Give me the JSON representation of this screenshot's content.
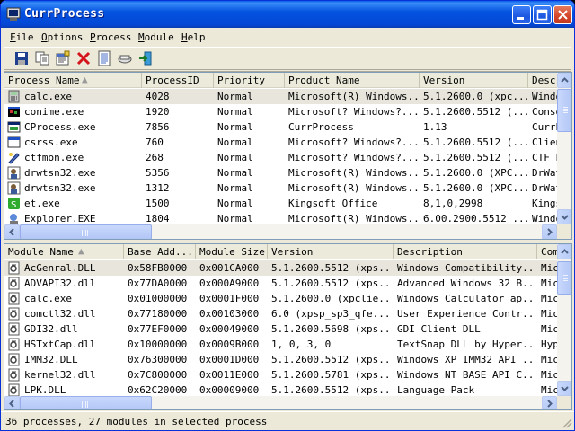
{
  "window": {
    "title": "CurrProcess",
    "colors": {
      "titlebar": "#0453e0",
      "selected_row": "#e8e6dc"
    }
  },
  "menu": [
    {
      "first": "F",
      "rest": "ile"
    },
    {
      "first": "O",
      "rest": "ptions"
    },
    {
      "first": "P",
      "rest": "rocess"
    },
    {
      "first": "M",
      "rest": "odule"
    },
    {
      "first": "H",
      "rest": "elp"
    }
  ],
  "toolbar": [
    "save-icon",
    "copy-icon",
    "properties-icon",
    "kill-process-icon",
    "html-report-icon",
    "refresh-icon",
    "exit-icon"
  ],
  "processes": {
    "columns": [
      "Process Name",
      "ProcessID",
      "Priority",
      "Product Name",
      "Version",
      "Descr"
    ],
    "rows": [
      {
        "icon": "calculator-icon",
        "name": "calc.exe",
        "pid": "4028",
        "priority": "Normal",
        "product": "Microsoft(R) Windows...",
        "version": "5.1.2600.0 (xpc...",
        "desc": "Windo"
      },
      {
        "icon": "console-icon",
        "name": "conime.exe",
        "pid": "1920",
        "priority": "Normal",
        "product": "Microsoft? Windows?...",
        "version": "5.1.2600.5512 (...",
        "desc": "Conso"
      },
      {
        "icon": "application-icon",
        "name": "CProcess.exe",
        "pid": "7856",
        "priority": "Normal",
        "product": "CurrProcess",
        "version": "1.13",
        "desc": "CurrP"
      },
      {
        "icon": "window-icon",
        "name": "csrss.exe",
        "pid": "760",
        "priority": "Normal",
        "product": "Microsoft? Windows?...",
        "version": "5.1.2600.5512 (...",
        "desc": "Clien"
      },
      {
        "icon": "ctf-icon",
        "name": "ctfmon.exe",
        "pid": "268",
        "priority": "Normal",
        "product": "Microsoft? Windows?...",
        "version": "5.1.2600.5512 (...",
        "desc": "CTF L"
      },
      {
        "icon": "drwatson-icon",
        "name": "drwtsn32.exe",
        "pid": "5356",
        "priority": "Normal",
        "product": "Microsoft(R) Windows...",
        "version": "5.1.2600.0 (XPC...",
        "desc": "DrWat"
      },
      {
        "icon": "drwatson-icon",
        "name": "drwtsn32.exe",
        "pid": "1312",
        "priority": "Normal",
        "product": "Microsoft(R) Windows...",
        "version": "5.1.2600.0 (XPC...",
        "desc": "DrWat"
      },
      {
        "icon": "kingsoft-icon",
        "name": "et.exe",
        "pid": "1500",
        "priority": "Normal",
        "product": "Kingsoft Office",
        "version": "8,1,0,2998",
        "desc": "Kings"
      },
      {
        "icon": "explorer-icon",
        "name": "Explorer.EXE",
        "pid": "1804",
        "priority": "Normal",
        "product": "Microsoft(R) Windows...",
        "version": "6.00.2900.5512 ...",
        "desc": "Windo"
      }
    ]
  },
  "modules": {
    "columns": [
      "Module Name",
      "Base Add...",
      "Module Size",
      "Version",
      "Description",
      "Com"
    ],
    "rows": [
      {
        "name": "AcGenral.DLL",
        "base": "0x58FB0000",
        "size": "0x001CA000",
        "version": "5.1.2600.5512 (xps...",
        "desc": "Windows Compatibility...",
        "com": "Mic"
      },
      {
        "name": "ADVAPI32.dll",
        "base": "0x77DA0000",
        "size": "0x000A9000",
        "version": "5.1.2600.5512 (xps...",
        "desc": "Advanced Windows 32 B...",
        "com": "Mic"
      },
      {
        "name": "calc.exe",
        "base": "0x01000000",
        "size": "0x0001F000",
        "version": "5.1.2600.0 (xpclie...",
        "desc": "Windows Calculator ap...",
        "com": "Mic"
      },
      {
        "name": "comctl32.dll",
        "base": "0x77180000",
        "size": "0x00103000",
        "version": "6.0 (xpsp_sp3_qfe....",
        "desc": "User Experience Contr...",
        "com": "Mic"
      },
      {
        "name": "GDI32.dll",
        "base": "0x77EF0000",
        "size": "0x00049000",
        "version": "5.1.2600.5698 (xps...",
        "desc": "GDI Client DLL",
        "com": "Mic"
      },
      {
        "name": "HSTxtCap.dll",
        "base": "0x10000000",
        "size": "0x0009B000",
        "version": "1, 0, 3, 0",
        "desc": "TextSnap DLL by Hyper...",
        "com": "Hyp"
      },
      {
        "name": "IMM32.DLL",
        "base": "0x76300000",
        "size": "0x0001D000",
        "version": "5.1.2600.5512 (xps...",
        "desc": "Windows XP IMM32 API ...",
        "com": "Mic"
      },
      {
        "name": "kernel32.dll",
        "base": "0x7C800000",
        "size": "0x0011E000",
        "version": "5.1.2600.5781 (xps...",
        "desc": "Windows NT BASE API C...",
        "com": "Mic"
      },
      {
        "name": "LPK.DLL",
        "base": "0x62C20000",
        "size": "0x00009000",
        "version": "5.1.2600.5512 (xps...",
        "desc": "Language Pack",
        "com": "Mic"
      }
    ]
  },
  "status": {
    "text": "36 processes, 27 modules in selected process"
  }
}
